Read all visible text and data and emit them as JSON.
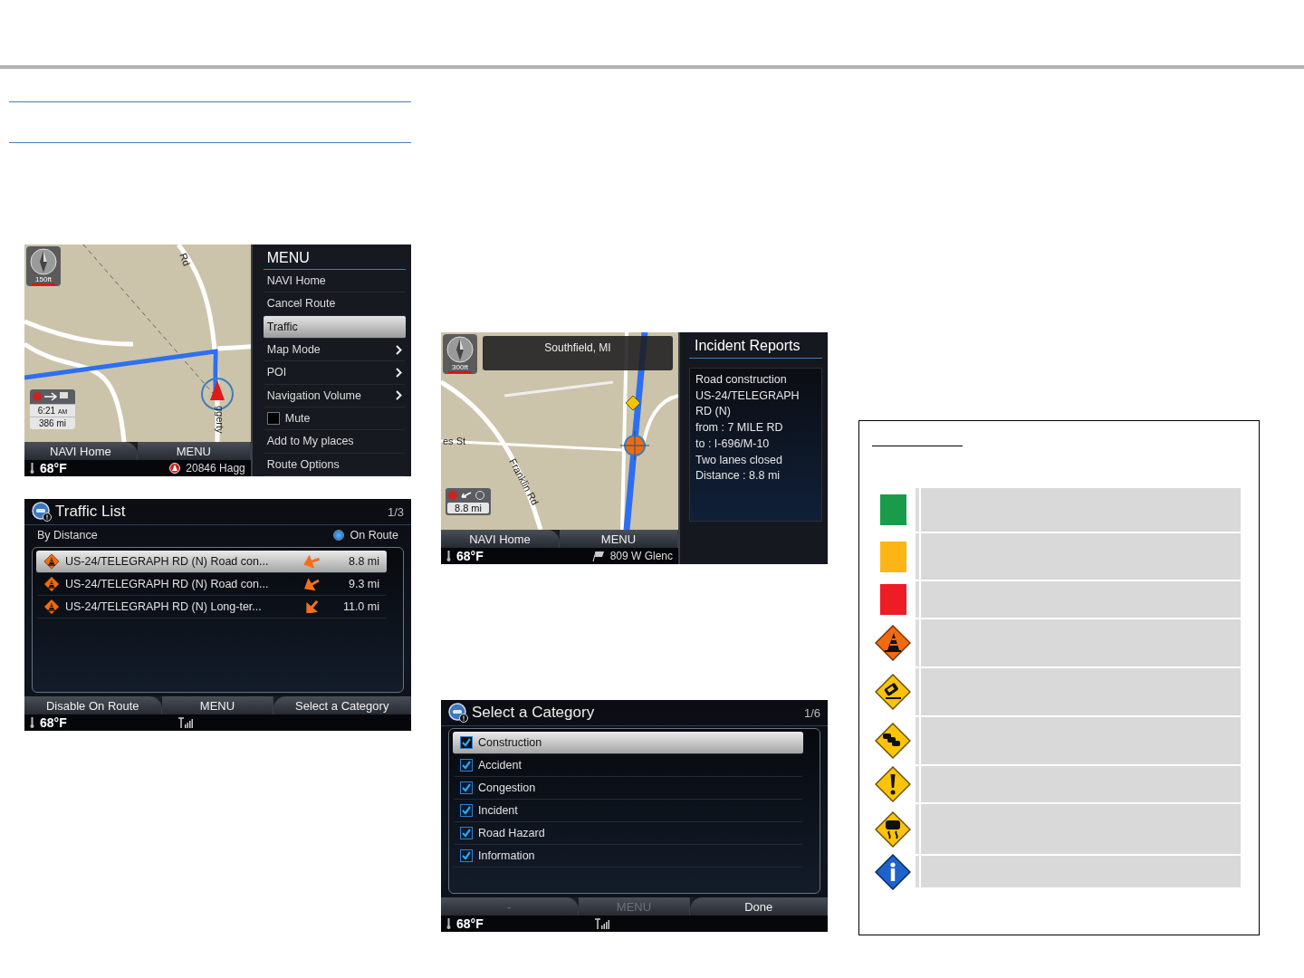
{
  "menu_screen": {
    "compass_scale": "150ft",
    "map_labels": [
      "Rd",
      "ggerty"
    ],
    "eta": {
      "time": "6:21",
      "ampm": "AM",
      "distance": "386 mi"
    },
    "soft_keys": [
      {
        "label": "NAVI Home",
        "disabled": false
      },
      {
        "label": "MENU",
        "disabled": false
      }
    ],
    "temperature": "68°F",
    "address": "20846 Hagg",
    "menu": {
      "title": "MENU",
      "items": [
        {
          "label": "NAVI Home",
          "kind": "plain",
          "selected": false
        },
        {
          "label": "Cancel Route",
          "kind": "plain",
          "selected": false
        },
        {
          "label": "Traffic",
          "kind": "plain",
          "selected": true
        },
        {
          "label": "Map Mode",
          "kind": "submenu",
          "selected": false
        },
        {
          "label": "POI",
          "kind": "submenu",
          "selected": false
        },
        {
          "label": "Navigation Volume",
          "kind": "submenu",
          "selected": false
        },
        {
          "label": "Mute",
          "kind": "checkbox",
          "checked": false,
          "selected": false
        },
        {
          "label": "Add to My places",
          "kind": "plain",
          "selected": false
        },
        {
          "label": "Route Options",
          "kind": "plain",
          "selected": false
        }
      ]
    }
  },
  "traffic_list_screen": {
    "title": "Traffic List",
    "page": "1/3",
    "sort": "By Distance",
    "filter": {
      "label": "On Route",
      "on": true
    },
    "rows": [
      {
        "text": "US-24/TELEGRAPH RD (N) Road con...",
        "distance": "8.8 mi",
        "selected": true
      },
      {
        "text": "US-24/TELEGRAPH RD (N) Road con...",
        "distance": "9.3 mi",
        "selected": false
      },
      {
        "text": "US-24/TELEGRAPH RD (N) Long-ter...",
        "distance": "11.0 mi",
        "selected": false
      }
    ],
    "soft_keys": [
      {
        "label": "Disable On Route",
        "disabled": false
      },
      {
        "label": "MENU",
        "disabled": false
      },
      {
        "label": "Select a Category",
        "disabled": false
      }
    ],
    "temperature": "68°F"
  },
  "incident_screen": {
    "location": "Southfield, MI",
    "compass_scale": "300ft",
    "map_labels": [
      "es St",
      "Franklin Rd"
    ],
    "distance": "8.8 mi",
    "soft_keys": [
      {
        "label": "NAVI Home",
        "disabled": false
      },
      {
        "label": "MENU",
        "disabled": false
      }
    ],
    "temperature": "68°F",
    "address": "809 W Glenc",
    "panel": {
      "title": "Incident Reports",
      "lines": [
        "Road construction",
        "US-24/TELEGRAPH",
        "RD (N)",
        "from : 7 MILE RD",
        "to : I-696/M-10",
        "Two lanes closed",
        "Distance : 8.8 mi"
      ]
    }
  },
  "category_screen": {
    "title": "Select a Category",
    "page": "1/6",
    "items": [
      {
        "label": "Construction",
        "checked": true,
        "selected": true
      },
      {
        "label": "Accident",
        "checked": true,
        "selected": false
      },
      {
        "label": "Congestion",
        "checked": true,
        "selected": false
      },
      {
        "label": "Incident",
        "checked": true,
        "selected": false
      },
      {
        "label": "Road Hazard",
        "checked": true,
        "selected": false
      },
      {
        "label": "Information",
        "checked": true,
        "selected": false
      }
    ],
    "soft_keys": [
      {
        "label": "-",
        "disabled": true
      },
      {
        "label": "MENU",
        "disabled": true
      },
      {
        "label": "Done",
        "disabled": false
      }
    ],
    "temperature": "68°F"
  },
  "legend": {
    "rows": [
      {
        "kind": "swatch",
        "color": "#1a9b4a"
      },
      {
        "kind": "swatch",
        "color": "#fdb515"
      },
      {
        "kind": "swatch",
        "color": "#ee1c25"
      },
      {
        "kind": "cone"
      },
      {
        "kind": "crash"
      },
      {
        "kind": "traffic"
      },
      {
        "kind": "warning"
      },
      {
        "kind": "skid"
      },
      {
        "kind": "info"
      }
    ]
  }
}
